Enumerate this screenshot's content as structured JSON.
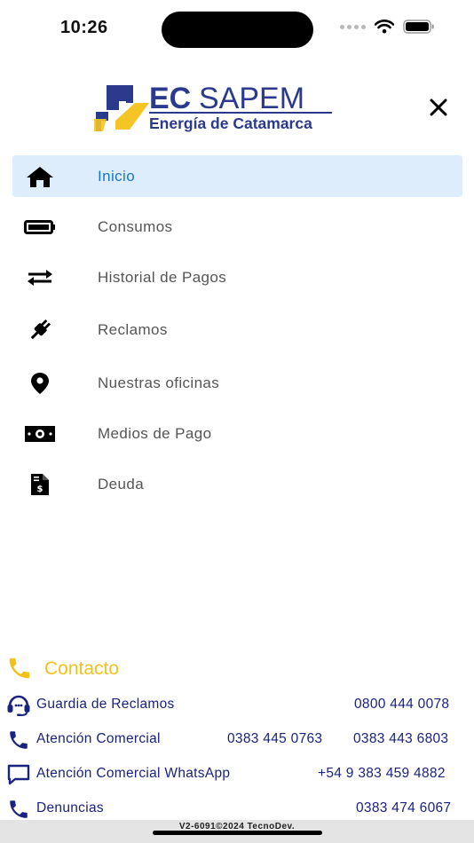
{
  "status": {
    "time": "10:26"
  },
  "logo": {
    "brand": "EC SAPEM",
    "tagline": "Energía de Catamarca"
  },
  "menu": {
    "items": [
      {
        "label": "Inicio",
        "icon": "home-icon",
        "active": true
      },
      {
        "label": "Consumos",
        "icon": "battery-icon"
      },
      {
        "label": "Historial de Pagos",
        "icon": "exchange-arrows-icon"
      },
      {
        "label": "Reclamos",
        "icon": "plug-icon"
      },
      {
        "label": "Nuestras oficinas",
        "icon": "location-pin-icon"
      },
      {
        "label": "Medios de Pago",
        "icon": "money-bill-icon"
      },
      {
        "label": "Deuda",
        "icon": "invoice-dollar-icon"
      }
    ]
  },
  "contact": {
    "title": "Contacto",
    "rows": [
      {
        "label": "Guardia de Reclamos",
        "icon": "headset-icon",
        "numbers": [
          "0800 444 0078"
        ]
      },
      {
        "label": "Atención Comercial",
        "icon": "phone-icon",
        "numbers": [
          "0383 445 0763",
          "0383 443 6803"
        ]
      },
      {
        "label": "Atención Comercial WhatsApp",
        "icon": "chat-icon",
        "numbers": [
          "+54 9 383 459 4882"
        ]
      },
      {
        "label": "Denuncias",
        "icon": "phone-icon",
        "numbers": [
          "0383 474 6067"
        ]
      }
    ]
  },
  "footer": {
    "text": "V2-6091©2024 TecnoDev."
  },
  "colors": {
    "accent": "#1976d2",
    "active_bg": "#deedfb",
    "contact_title": "#f2c21b",
    "contact_text": "#1a2380",
    "logo_navy": "#2b3a8c",
    "logo_yellow": "#f5c526"
  }
}
